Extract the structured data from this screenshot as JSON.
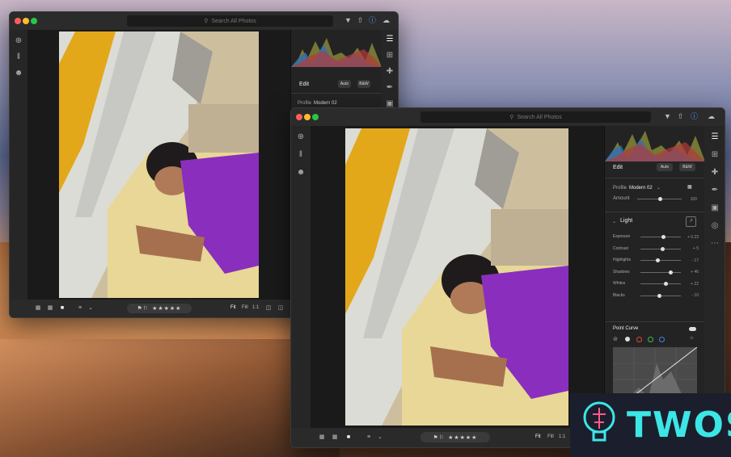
{
  "app": {
    "search_placeholder": "Search All Photos",
    "fit_labels": {
      "fit": "Fit",
      "fill": "Fill",
      "one_to_one": "1:1"
    },
    "rating_stars": "★★★★★",
    "rating_value": 3,
    "accent_color": "#4da3ff"
  },
  "edit_panel": {
    "title": "Edit",
    "auto_label": "Auto",
    "bw_label": "B&W",
    "profile_label": "Profile",
    "profile_value": "Modern 02",
    "amount_label": "Amount",
    "amount_value": "100",
    "light_section": "Light",
    "sliders": [
      {
        "label": "Exposure",
        "value": "+ 0.23",
        "pos": 0.56
      },
      {
        "label": "Contrast",
        "value": "+ 5",
        "pos": 0.53
      },
      {
        "label": "Highlights",
        "value": "- 17",
        "pos": 0.42
      },
      {
        "label": "Shadows",
        "value": "+ 46",
        "pos": 0.73
      },
      {
        "label": "Whites",
        "value": "+ 22",
        "pos": 0.61
      },
      {
        "label": "Blacks",
        "value": "- 10",
        "pos": 0.45
      }
    ],
    "point_curve_title": "Point Curve",
    "curve_channels": [
      "white",
      "red",
      "green",
      "blue"
    ]
  },
  "watermark": {
    "brand": "TWOS"
  },
  "icons": {
    "add": "plus-circle-icon",
    "library": "library-icon",
    "people": "people-icon",
    "filter": "filter-icon",
    "share": "share-icon",
    "help": "help-icon",
    "cloud": "cloud-icon",
    "edit": "sliders-icon",
    "crop": "crop-icon",
    "heal": "bandage-icon",
    "brush": "brush-icon",
    "gradient": "linear-gradient-icon",
    "radial": "radial-gradient-icon",
    "more": "more-icon"
  }
}
